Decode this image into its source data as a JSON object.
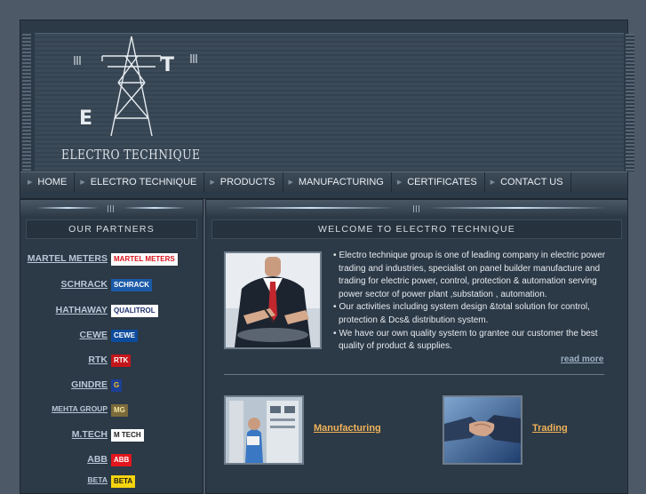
{
  "logo": {
    "text": "ELECTRO TECHNIQUE",
    "letters": [
      "E",
      "T"
    ]
  },
  "nav": {
    "items": [
      "HOME",
      "ELECTRO TECHNIQUE",
      "PRODUCTS",
      "MANUFACTURING",
      "CERTIFICATES",
      "CONTACT US"
    ]
  },
  "partners": {
    "title": "OUR PARTNERS",
    "items": [
      {
        "name": "MARTEL METERS",
        "logo": "MARTEL METERS",
        "bg": "#ffffff",
        "fg": "#d8121b"
      },
      {
        "name": "SCHRACK",
        "logo": "SCHRACK",
        "bg": "#1b5aa8",
        "fg": "#ffffff"
      },
      {
        "name": "HATHAWAY",
        "logo": "QUALITROL",
        "bg": "#ffffff",
        "fg": "#1e2f6d"
      },
      {
        "name": "CEWE",
        "logo": "CEWE",
        "bg": "#0d4b9d",
        "fg": "#ffffff"
      },
      {
        "name": "RTK",
        "logo": "RTK",
        "bg": "#c3161c",
        "fg": "#ffffff"
      },
      {
        "name": "GINDRE",
        "logo": "G",
        "bg": "#1d3f95",
        "fg": "#f2c21b"
      },
      {
        "name": "MEHTA GROUP",
        "logo": "MG",
        "bg": "#7a6a3c",
        "fg": "#f7e4a0"
      },
      {
        "name": "M.TECH",
        "logo": "M TECH",
        "bg": "#ffffff",
        "fg": "#222222"
      },
      {
        "name": "ABB",
        "logo": "ABB",
        "bg": "#e3161e",
        "fg": "#ffffff"
      },
      {
        "name": "BETA",
        "logo": "BETA",
        "bg": "#f5d40f",
        "fg": "#1a1a1a"
      }
    ]
  },
  "welcome": {
    "title": "WELCOME TO ELECTRO TECHNIQUE",
    "paragraphs": [
      "Electro technique group is one of leading company in electric power trading and industries, specialist on panel builder manufacture and trading for electric power, control, protection & automation serving power sector of power plant ,substation , automation.",
      "Our activities including system design &total solution for control, protection & Dcs& distribution system.",
      "We have our own quality system to grantee our customer the best quality of product & supplies."
    ],
    "read_more": "read more"
  },
  "features": [
    {
      "label": "Manufacturing"
    },
    {
      "label": "Trading"
    }
  ],
  "colors": {
    "accent_link": "#f0b45a",
    "partner_link": "#b9c7d8",
    "panel": "#2c3946",
    "background": "#4d5966"
  }
}
